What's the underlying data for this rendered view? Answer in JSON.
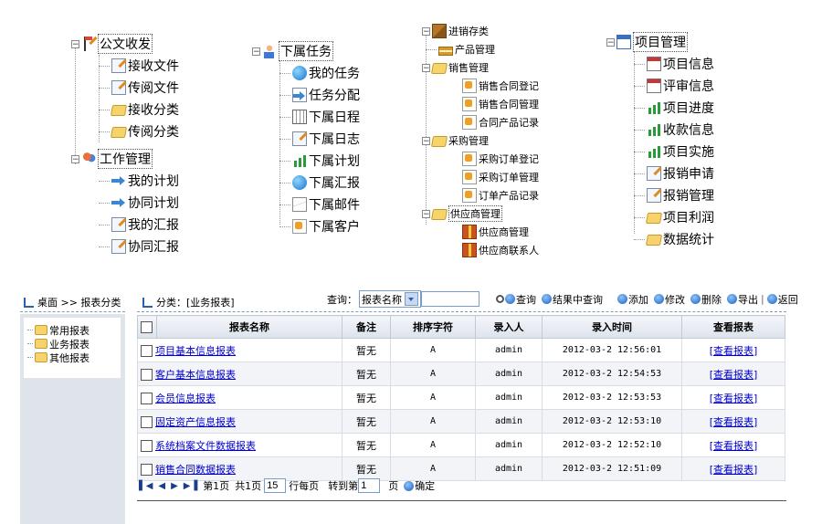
{
  "tree1": {
    "root1": "公文收发",
    "items1": [
      "接收文件",
      "传阅文件",
      "接收分类",
      "传阅分类"
    ],
    "root2": "工作管理",
    "items2": [
      "我的计划",
      "协同计划",
      "我的汇报",
      "协同汇报"
    ]
  },
  "tree2": {
    "root": "下属任务",
    "items": [
      "我的任务",
      "任务分配",
      "下属日程",
      "下属日志",
      "下属计划",
      "下属汇报",
      "下属邮件",
      "下属客户"
    ]
  },
  "tree3": {
    "root": "进销存类",
    "product": "产品管理",
    "sales": "销售管理",
    "sales_items": [
      "销售合同登记",
      "销售合同管理",
      "合同产品记录"
    ],
    "purchase": "采购管理",
    "purchase_items": [
      "采购订单登记",
      "采购订单管理",
      "订单产品记录"
    ],
    "supplier": "供应商管理",
    "supplier_items": [
      "供应商管理",
      "供应商联系人"
    ]
  },
  "tree4": {
    "root": "项目管理",
    "items": [
      "项目信息",
      "评审信息",
      "项目进度",
      "收款信息",
      "项目实施",
      "报销申请",
      "报销管理",
      "项目利润",
      "数据统计"
    ]
  },
  "breadcrumb_left": "桌面 >> 报表分类",
  "breadcrumb_right": "分类：[业务报表]",
  "categories": [
    "常用报表",
    "业务报表",
    "其他报表"
  ],
  "query": {
    "label": "查询：",
    "select_value": "报表名称",
    "search_btn": "查询",
    "search_in_results_btn": "结果中查询",
    "add_btn": "添加",
    "edit_btn": "修改",
    "delete_btn": "删除",
    "export_btn": "导出",
    "back_btn": "返回"
  },
  "table": {
    "headers": [
      "报表名称",
      "备注",
      "排序字符",
      "录入人",
      "录入时间",
      "查看报表"
    ],
    "rows": [
      {
        "name": "项目基本信息报表",
        "note": "暂无",
        "sort": "A",
        "user": "admin",
        "time": "2012-03-2 12:56:01",
        "view": "[查看报表]"
      },
      {
        "name": "客户基本信息报表",
        "note": "暂无",
        "sort": "A",
        "user": "admin",
        "time": "2012-03-2 12:54:53",
        "view": "[查看报表]"
      },
      {
        "name": "会员信息报表",
        "note": "暂无",
        "sort": "A",
        "user": "admin",
        "time": "2012-03-2 12:53:53",
        "view": "[查看报表]"
      },
      {
        "name": "固定资产信息报表",
        "note": "暂无",
        "sort": "A",
        "user": "admin",
        "time": "2012-03-2 12:53:10",
        "view": "[查看报表]"
      },
      {
        "name": "系统档案文件数据报表",
        "note": "暂无",
        "sort": "A",
        "user": "admin",
        "time": "2012-03-2 12:52:10",
        "view": "[查看报表]"
      },
      {
        "name": "销售合同数据报表",
        "note": "暂无",
        "sort": "A",
        "user": "admin",
        "time": "2012-03-2 12:51:09",
        "view": "[查看报表]"
      }
    ]
  },
  "pager": {
    "page_text": "第1页",
    "total_text": "共1页",
    "per_page_value": "15",
    "per_page_label": "行每页",
    "goto_label": "转到第",
    "goto_value": "1",
    "page_unit": "页",
    "confirm": "确定"
  }
}
